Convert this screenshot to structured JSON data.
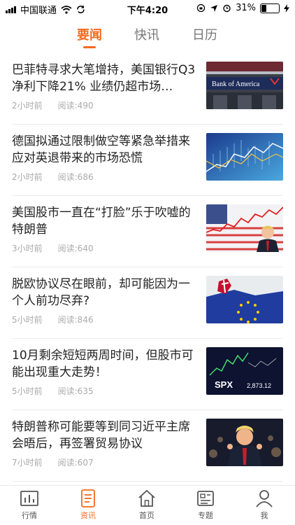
{
  "status": {
    "carrier": "中国联通",
    "time": "下午4:20",
    "battery": "31%",
    "battery_level": 0.31
  },
  "tabs": [
    {
      "label": "要闻",
      "active": true
    },
    {
      "label": "快讯",
      "active": false
    },
    {
      "label": "日历",
      "active": false
    }
  ],
  "news": [
    {
      "title": "巴菲特寻求大笔增持，美国银行Q3净利下降21% 业绩仍超市场…",
      "time": "2小时前",
      "reads": "阅读:490",
      "thumb_text": "Bank of America"
    },
    {
      "title": "德国拟通过限制做空等紧急举措来应对英退带来的市场恐慌",
      "time": "2小时前",
      "reads": "阅读:686"
    },
    {
      "title": "美国股市一直在“打脸”乐于吹嘘的特朗普",
      "time": "3小时前",
      "reads": "阅读:640"
    },
    {
      "title": "脱欧协议尽在眼前，却可能因为一个人前功尽弃?",
      "time": "5小时前",
      "reads": "阅读:846"
    },
    {
      "title": "10月剩余短短两周时间，但股市可能出现重大走势！",
      "time": "5小时前",
      "reads": "阅读:635",
      "thumb_text": "SPX",
      "thumb_num": "2,873.12"
    },
    {
      "title": "特朗普称可能要等到同习近平主席会晤后，再签署贸易协议",
      "time": "7小时前",
      "reads": "阅读:607"
    }
  ],
  "bottom_nav": [
    {
      "label": "行情",
      "icon": "chart-icon",
      "active": false
    },
    {
      "label": "资讯",
      "icon": "document-icon",
      "active": true
    },
    {
      "label": "首页",
      "icon": "home-icon",
      "active": false
    },
    {
      "label": "专题",
      "icon": "topic-card-icon",
      "active": false
    },
    {
      "label": "我",
      "icon": "user-icon",
      "active": false
    }
  ],
  "colors": {
    "accent": "#f26a1d"
  }
}
